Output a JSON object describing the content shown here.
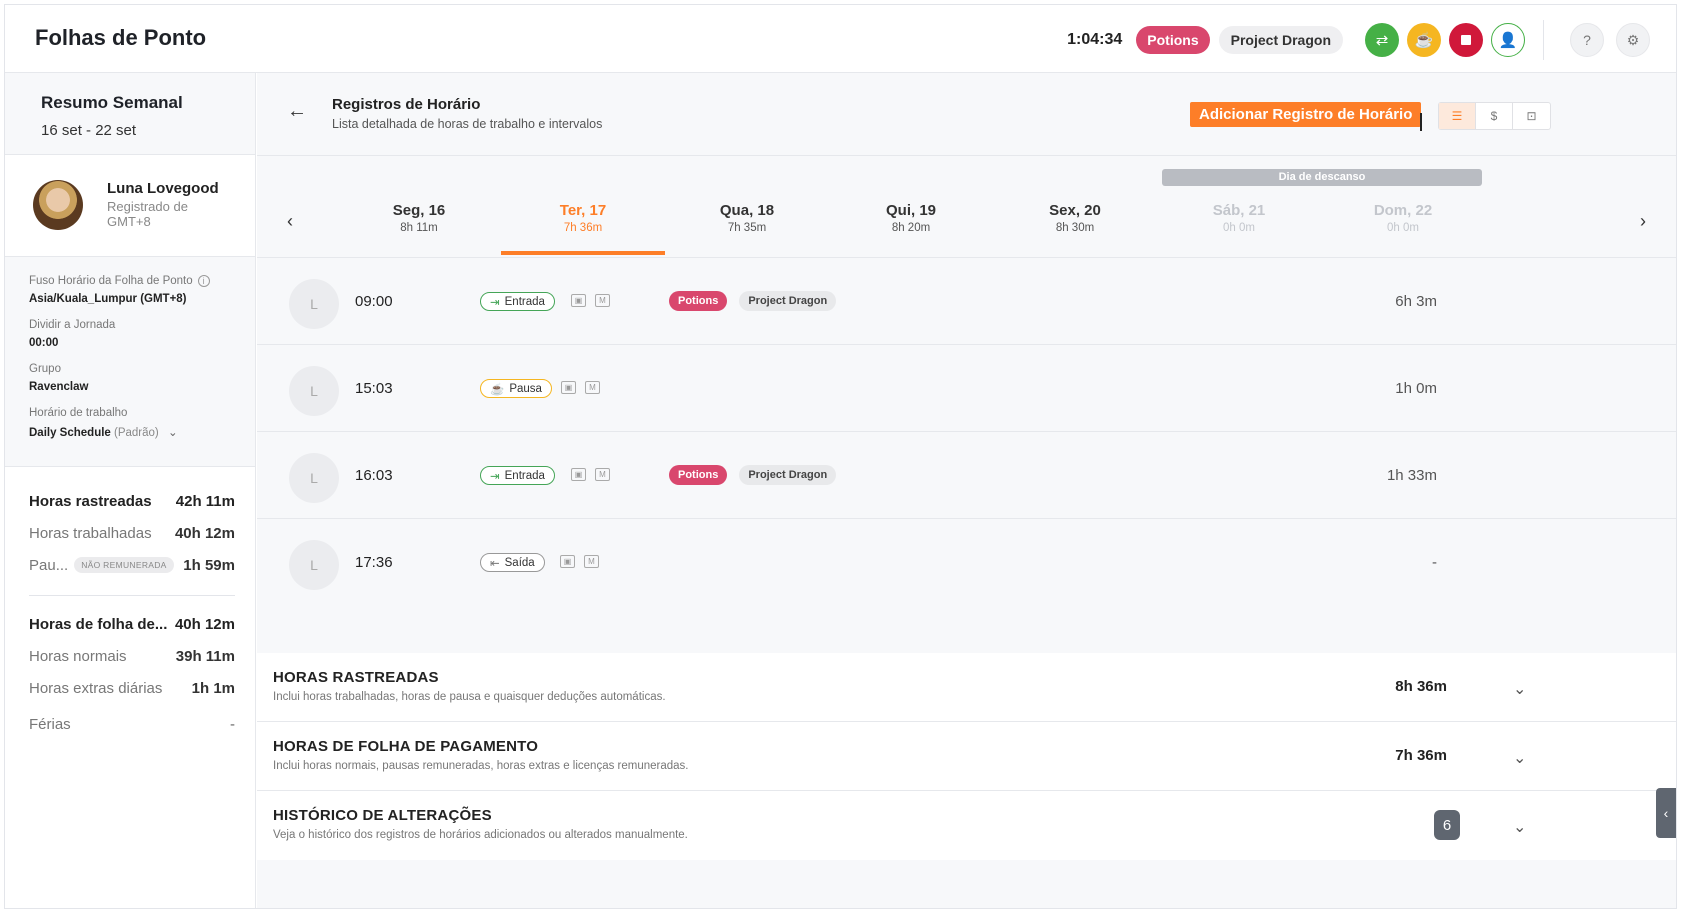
{
  "header": {
    "title": "Folhas de Ponto",
    "timer": "1:04:34",
    "project_tag": "Potions",
    "project_name": "Project Dragon"
  },
  "colors": {
    "accent": "#fd7e28",
    "potions": "#d9476d",
    "green": "#45b046",
    "yellow": "#f5b621",
    "red": "#d0183a"
  },
  "sidebar": {
    "weekly_title": "Resumo Semanal",
    "weekly_range": "16 set - 22 set",
    "user_name": "Luna Lovegood",
    "user_sub": "Registrado de GMT+8",
    "fields": [
      {
        "label": "Fuso Horário da Folha de Ponto",
        "value": "Asia/Kuala_Lumpur (GMT+8)"
      },
      {
        "label": "Dividir a Jornada",
        "value": "00:00"
      },
      {
        "label": "Grupo",
        "value": "Ravenclaw"
      },
      {
        "label": "Horário de trabalho",
        "value": "Daily Schedule",
        "suffix": "(Padrão)"
      }
    ],
    "summary": {
      "tracked_label": "Horas rastreadas",
      "tracked_value": "42h 11m",
      "worked_label": "Horas trabalhadas",
      "worked_value": "40h 12m",
      "pause_label": "Pau...",
      "pause_badge": "NÃO REMUNERADA",
      "pause_value": "1h 59m",
      "payroll_label": "Horas de folha de...",
      "payroll_value": "40h 12m",
      "normal_label": "Horas normais",
      "normal_value": "39h 11m",
      "overtime_label": "Horas extras diárias",
      "overtime_value": "1h 1m",
      "vacation_label": "Férias",
      "vacation_value": "-"
    }
  },
  "main": {
    "title": "Registros de Horário",
    "subtitle": "Lista detalhada de horas de trabalho e intervalos",
    "add_button": "Adicionar Registro de Horário",
    "rest_label": "Dia de descanso",
    "days": [
      {
        "name": "Seg, 16",
        "hours": "8h 11m"
      },
      {
        "name": "Ter, 17",
        "hours": "7h 36m"
      },
      {
        "name": "Qua, 18",
        "hours": "7h 35m"
      },
      {
        "name": "Qui, 19",
        "hours": "8h 20m"
      },
      {
        "name": "Sex, 20",
        "hours": "8h 30m"
      },
      {
        "name": "Sáb, 21",
        "hours": "0h 0m"
      },
      {
        "name": "Dom, 22",
        "hours": "0h 0m"
      }
    ],
    "entries": [
      {
        "avatar": "L",
        "time": "09:00",
        "type": "Entrada",
        "tag": "Potions",
        "project": "Project Dragon",
        "duration": "6h 3m"
      },
      {
        "avatar": "L",
        "time": "15:03",
        "type": "Pausa",
        "duration": "1h 0m"
      },
      {
        "avatar": "L",
        "time": "16:03",
        "type": "Entrada",
        "tag": "Potions",
        "project": "Project Dragon",
        "duration": "1h 33m"
      },
      {
        "avatar": "L",
        "time": "17:36",
        "type": "Saída",
        "duration": "-"
      }
    ],
    "manual_mark": "M",
    "accordions": [
      {
        "title": "HORAS RASTREADAS",
        "subtitle": "Inclui horas trabalhadas, horas de pausa e quaisquer deduções automáticas.",
        "value": "8h 36m"
      },
      {
        "title": "HORAS DE FOLHA DE PAGAMENTO",
        "subtitle": "Inclui horas normais, pausas remuneradas, horas extras e licenças remuneradas.",
        "value": "7h 36m"
      },
      {
        "title": "HISTÓRICO DE ALTERAÇÕES",
        "subtitle": "Veja o histórico dos registros de horários adicionados ou alterados manualmente.",
        "count": "6"
      }
    ]
  }
}
